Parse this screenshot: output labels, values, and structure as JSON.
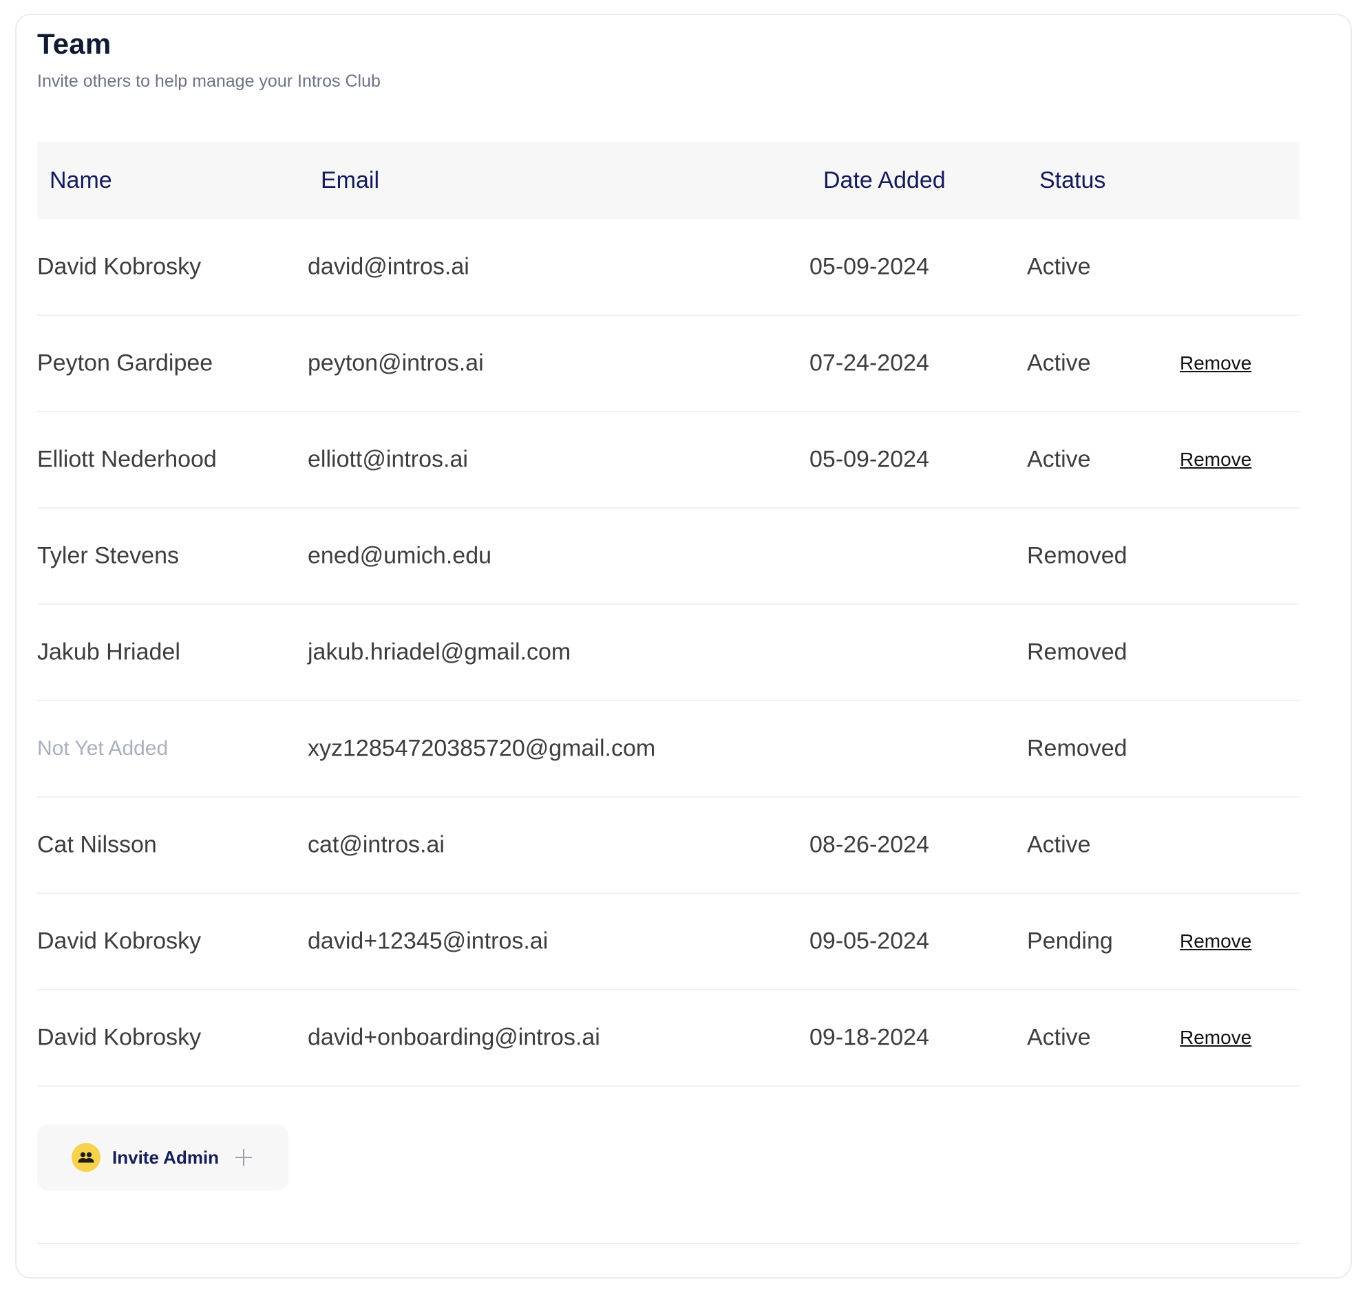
{
  "header": {
    "title": "Team",
    "subtitle": "Invite others to help manage your Intros Club"
  },
  "table": {
    "columns": {
      "name": "Name",
      "email": "Email",
      "date_added": "Date Added",
      "status": "Status"
    },
    "rows": [
      {
        "name": "David Kobrosky",
        "email": "david@intros.ai",
        "date": "05-09-2024",
        "status": "Active",
        "action": ""
      },
      {
        "name": "Peyton Gardipee",
        "email": "peyton@intros.ai",
        "date": "07-24-2024",
        "status": "Active",
        "action": "Remove"
      },
      {
        "name": "Elliott Nederhood",
        "email": "elliott@intros.ai",
        "date": "05-09-2024",
        "status": "Active",
        "action": "Remove"
      },
      {
        "name": "Tyler Stevens",
        "email": "ened@umich.edu",
        "date": "",
        "status": "Removed",
        "action": ""
      },
      {
        "name": "Jakub Hriadel",
        "email": "jakub.hriadel@gmail.com",
        "date": "",
        "status": "Removed",
        "action": ""
      },
      {
        "name": "Not Yet Added",
        "email": "xyz12854720385720@gmail.com",
        "date": "",
        "status": "Removed",
        "action": ""
      },
      {
        "name": "Cat Nilsson",
        "email": "cat@intros.ai",
        "date": "08-26-2024",
        "status": "Active",
        "action": ""
      },
      {
        "name": "David Kobrosky",
        "email": "david+12345@intros.ai",
        "date": "09-05-2024",
        "status": "Pending",
        "action": "Remove"
      },
      {
        "name": "David Kobrosky",
        "email": "david+onboarding@intros.ai",
        "date": "09-18-2024",
        "status": "Active",
        "action": "Remove"
      }
    ]
  },
  "invite": {
    "label": "Invite Admin",
    "icon": "people-icon",
    "icon_color": "#f7d24d",
    "plus_icon": "plus-icon"
  },
  "colors": {
    "header_text": "#131a5b",
    "placeholder_text": "#a9b0bd",
    "row_text": "#3d3d3d"
  }
}
